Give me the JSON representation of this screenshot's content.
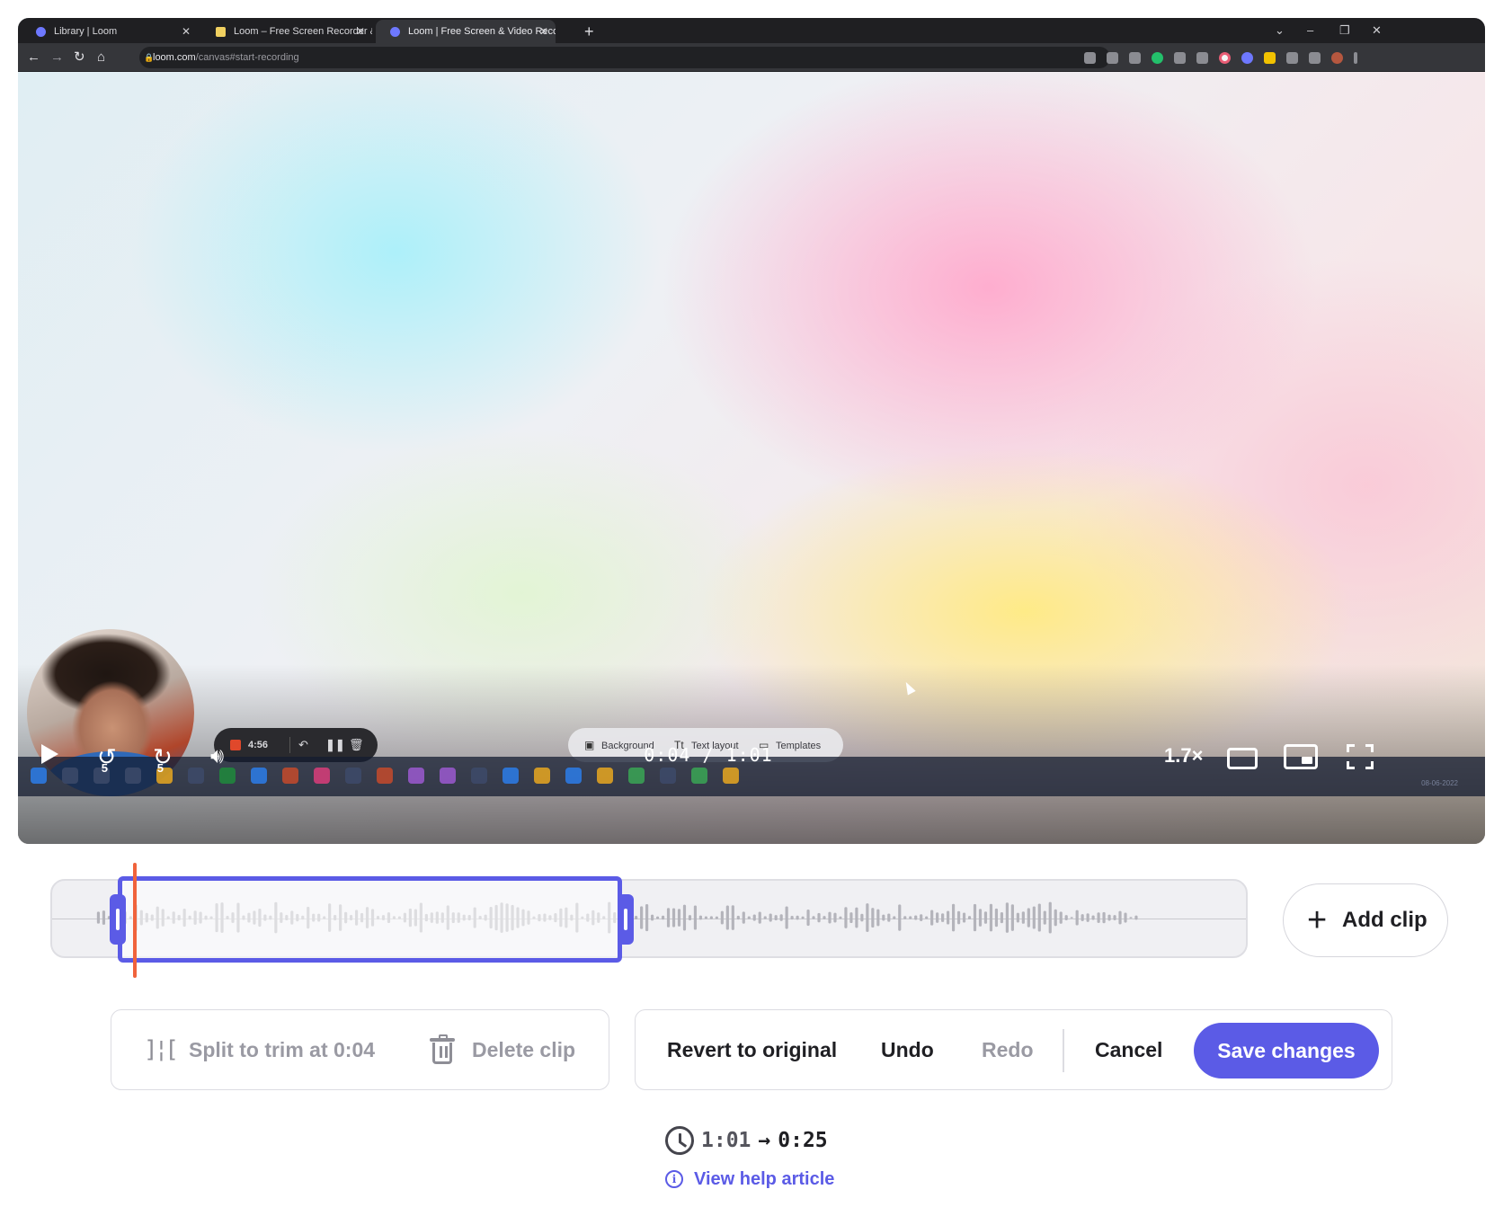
{
  "browser": {
    "tabs": [
      {
        "title": "Library | Loom"
      },
      {
        "title": "Loom – Free Screen Recorder & Screen Capture"
      },
      {
        "title": "Loom | Free Screen & Video Recording"
      }
    ],
    "new_tab": "+",
    "url_domain": "loom.com",
    "url_path": "/canvas#start-recording"
  },
  "recorder": {
    "elapsed": "4:56"
  },
  "canvas_toolbar": {
    "background_label": "Background",
    "text_layout_label": "Text layout",
    "templates_label": "Templates"
  },
  "taskbar": {
    "date": "08-06-2022"
  },
  "player": {
    "skip_back": "5",
    "skip_forward": "5",
    "current_time": "0:04",
    "separator": "/",
    "total_time": "1:01",
    "speed": "1.7×"
  },
  "timeline": {
    "playhead_time": "0:04",
    "selected_clip": {
      "start_fraction": 0.06,
      "end_fraction": 0.47
    }
  },
  "add_clip_label": "Add clip",
  "edit_actions": {
    "split_label": "Split to trim at 0:04",
    "delete_label": "Delete clip",
    "revert_label": "Revert to original",
    "undo_label": "Undo",
    "redo_label": "Redo",
    "cancel_label": "Cancel",
    "save_label": "Save changes"
  },
  "duration": {
    "original": "1:01",
    "arrow": "→",
    "new": "0:25"
  },
  "help_link_label": "View help article",
  "colors": {
    "accent": "#5b5be6",
    "playhead": "#f0633c",
    "recording": "#e0482b"
  }
}
